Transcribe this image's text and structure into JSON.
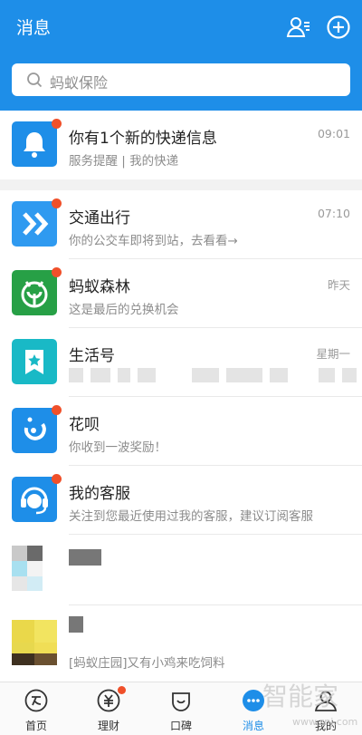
{
  "header": {
    "title": "消息"
  },
  "search": {
    "placeholder": "蚂蚁保险"
  },
  "colors": {
    "brand": "#1e8ee8",
    "badge": "#f0502a"
  },
  "messages": [
    {
      "title": "你有1个新的快递信息",
      "sub": "服务提醒 | 我的快递",
      "time": "09:01",
      "badge": true,
      "icon": "bell-icon"
    },
    {
      "title": "交通出行",
      "sub": "你的公交车即将到站，去看看→",
      "time": "07:10",
      "badge": true,
      "icon": "transit-icon"
    },
    {
      "title": "蚂蚁森林",
      "sub": "这是最后的兑换机会",
      "time": "昨天",
      "badge": true,
      "icon": "tree-icon"
    },
    {
      "title": "生活号",
      "sub": "",
      "time": "星期一",
      "badge": false,
      "icon": "star-bookmark-icon"
    },
    {
      "title": "花呗",
      "sub": "你收到一波奖励！",
      "time": "",
      "badge": true,
      "icon": "huabei-icon"
    },
    {
      "title": "我的客服",
      "sub": "关注到您最近使用过我的客服，建议订阅客服",
      "time": "",
      "badge": true,
      "icon": "customer-service-icon"
    },
    {
      "title": "",
      "sub": "",
      "time": "",
      "badge": false,
      "icon": "blurred-avatar"
    },
    {
      "title": "",
      "sub": "[蚂蚁庄园]又有小鸡来吃饲料",
      "time": "",
      "badge": false,
      "icon": "blurred-avatar"
    }
  ],
  "tabs": [
    {
      "label": "首页",
      "icon": "home-icon",
      "active": false
    },
    {
      "label": "理财",
      "icon": "wealth-icon",
      "active": false,
      "badge": true
    },
    {
      "label": "口碑",
      "icon": "koubei-icon",
      "active": false
    },
    {
      "label": "消息",
      "icon": "message-icon",
      "active": true
    },
    {
      "label": "我的",
      "icon": "profile-icon",
      "active": false
    }
  ],
  "watermark": {
    "text": "智能家",
    "url": "www.znj.com"
  }
}
